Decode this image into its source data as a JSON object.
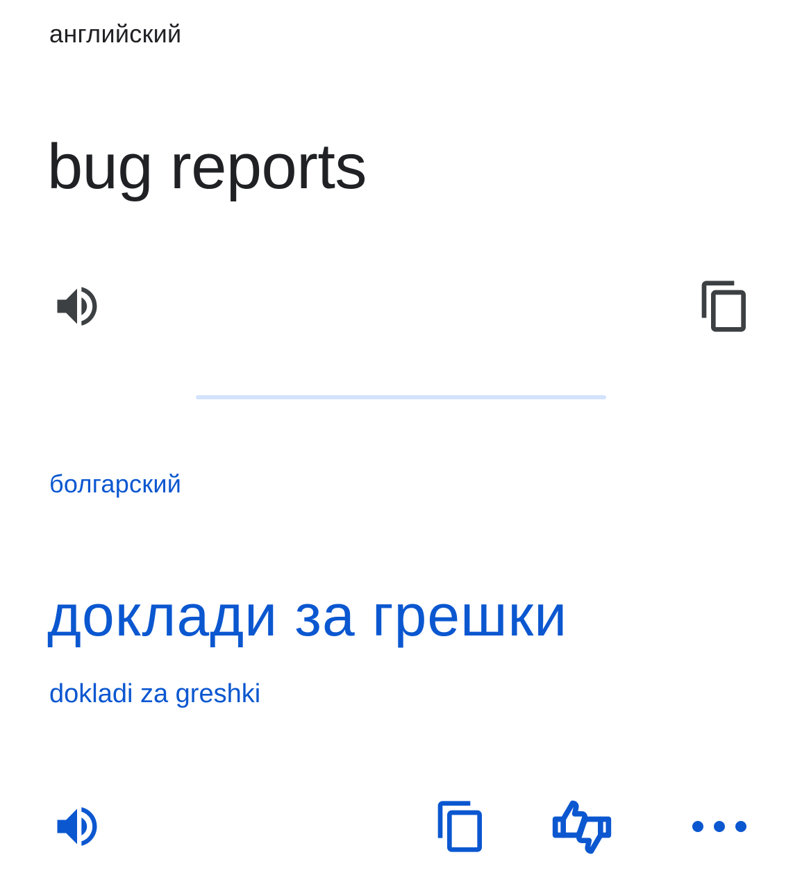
{
  "source": {
    "language": "английский",
    "text": "bug reports",
    "listen_icon": "speaker-icon",
    "copy_icon": "copy-icon"
  },
  "target": {
    "language": "болгарский",
    "text": "доклади за грешки",
    "transliteration": "dokladi za greshki",
    "listen_icon": "speaker-icon",
    "copy_icon": "copy-icon",
    "rate_icon": "thumbs-up-down-icon",
    "more_icon": "more-horizontal-icon"
  },
  "colors": {
    "source_text": "#202124",
    "source_icon": "#3c4043",
    "target_accent": "#0b57d0",
    "divider": "#d3e3fd",
    "background": "#ffffff"
  }
}
